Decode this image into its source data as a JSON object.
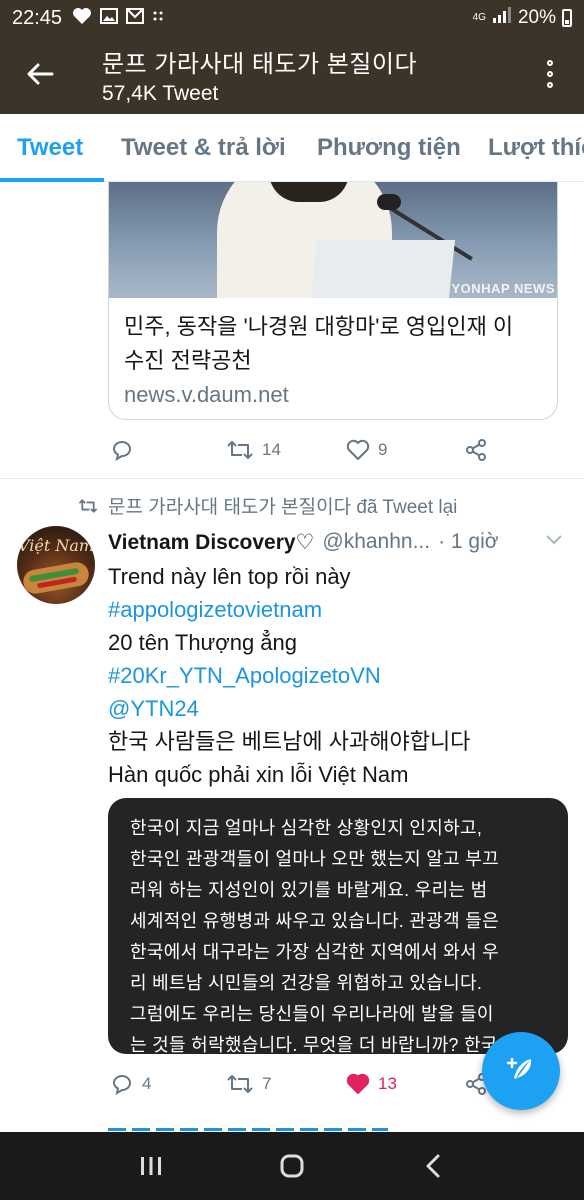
{
  "status_bar": {
    "time": "22:45",
    "network": "4G",
    "battery": "20%",
    "notification_icons": [
      "heart-icon",
      "image-icon",
      "gmail-icon",
      "dots-icon"
    ]
  },
  "header": {
    "title": "문프 가라사대 태도가 본질이다",
    "subtitle": "57,4K Tweet"
  },
  "tabs": [
    {
      "label": "Tweet",
      "active": true
    },
    {
      "label": "Tweet & trả lời",
      "active": false
    },
    {
      "label": "Phương tiện",
      "active": false
    },
    {
      "label": "Lượt thích",
      "active": false
    }
  ],
  "link_card": {
    "title_line1": "민주, 동작을 '나경원 대항마'로 영입인재 이",
    "title_line2": "수진 전략공천",
    "domain": "news.v.daum.net",
    "image_watermark": "YONHAP NEWS"
  },
  "first_tweet_actions": {
    "replies": "",
    "retweets": "14",
    "likes": "9"
  },
  "second_tweet": {
    "retweet_context": "문프 가라사대 태도가 본질이다 đã Tweet lại",
    "display_name": "Vietnam Discovery♡",
    "handle": "@khanhn...",
    "time": "· 1 giờ",
    "avatar_text": "Việt Nam",
    "text_lines": [
      {
        "text": "Trend này lên top rồi này",
        "is_link": false
      },
      {
        "text": "#appologizetovietnam",
        "is_link": true
      },
      {
        "text": "20 tên Thượng ẳng",
        "is_link": false
      },
      {
        "text": "#20Kr_YTN_ApologizetoVN",
        "is_link": true
      },
      {
        "text": "@YTN24",
        "is_link": true
      },
      {
        "text": "한국 사람들은 베트남에 사과해야합니다",
        "is_link": false
      },
      {
        "text": "Hàn quốc phải xin lỗi Việt Nam",
        "is_link": false
      }
    ],
    "image_text_lines": [
      "한국이 지금 얼마나 심각한 상황인지 인지하고,",
      "한국인 관광객들이 얼마나 오만 했는지 알고 부끄",
      "러워 하는 지성인이 있기를 바랄게요. 우리는 범",
      "세계적인 유행병과 싸우고 있습니다. 관광객 들은",
      "한국에서 대구라는 가장 심각한 지역에서 와서 우",
      "리 베트남 시민들의 건강을 위협하고 있습니다.",
      "그럼에도 우리는 당신들이 우리나라에 발을 들이",
      "는 것들 허락했습니다. 무엇을 더 바랍니까? 한국"
    ],
    "replies": "4",
    "retweets": "7",
    "likes": "13"
  },
  "colors": {
    "header_bg": "#3d3429",
    "accent": "#1da1f2",
    "link": "#1b95e0",
    "like": "#e0245e",
    "muted": "#657786"
  }
}
